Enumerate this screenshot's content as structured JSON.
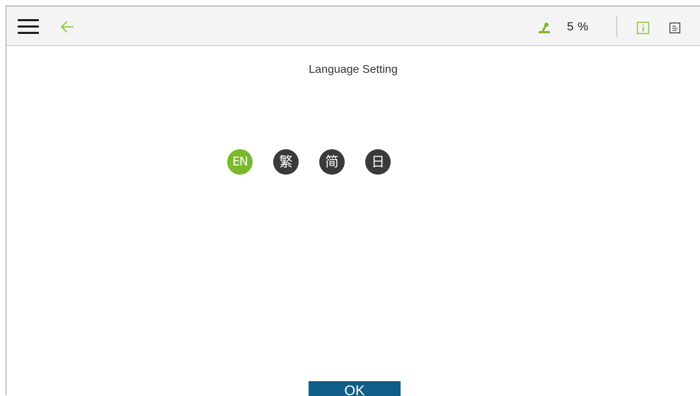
{
  "header": {
    "menu_icon": "hamburger-menu-icon",
    "back_icon": "arrow-left-icon",
    "status_icon": "robot-arm-icon",
    "speed_percent": "5 %",
    "info_icon": "info-icon",
    "log_icon": "log-icon",
    "accent_color": "#8cc63f"
  },
  "page": {
    "title": "Language Setting"
  },
  "languages": [
    {
      "label": "EN",
      "selected": true,
      "color": "#7ab929"
    },
    {
      "label": "繁",
      "selected": false,
      "color": "#3a3a3a"
    },
    {
      "label": "简",
      "selected": false,
      "color": "#3a3a3a"
    },
    {
      "label": "日",
      "selected": false,
      "color": "#3a3a3a"
    }
  ],
  "footer": {
    "ok_label": "OK",
    "ok_color": "#0f5f88"
  }
}
